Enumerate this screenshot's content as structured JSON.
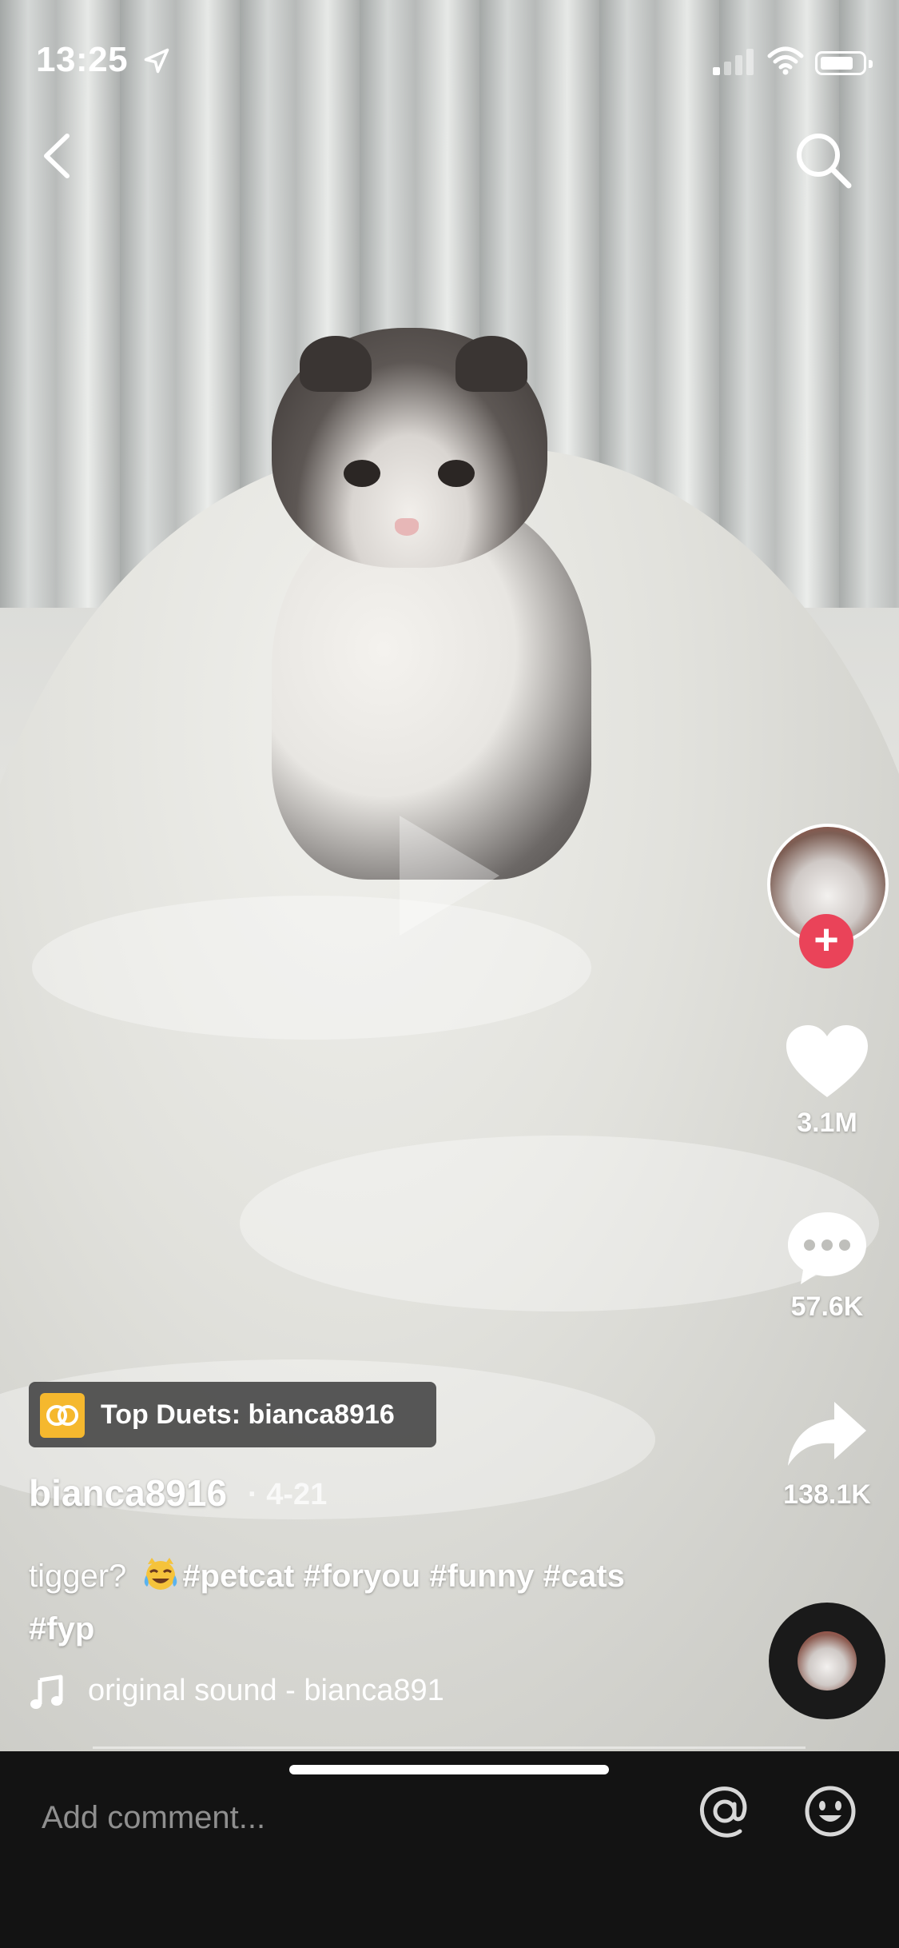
{
  "status_bar": {
    "time": "13:25"
  },
  "video": {
    "state": "paused"
  },
  "creator": {
    "username": "bianca8916",
    "date": "· 4-21"
  },
  "duets_chip": {
    "label": "Top Duets: bianca8916"
  },
  "caption": {
    "text": "tigger?",
    "emoji": "😹",
    "hashtags": "#petcat #foryou #funny #cats #fyp"
  },
  "sound": {
    "label": "original sound - bianca891"
  },
  "actions": {
    "likes": "3.1M",
    "comments": "57.6K",
    "shares": "138.1K"
  },
  "comment_bar": {
    "placeholder": "Add comment..."
  },
  "colors": {
    "accent": "#ea4359",
    "duets_icon": "#f5b82e",
    "bar_bg": "#131313"
  },
  "icons": [
    "back-icon",
    "search-icon",
    "play-icon",
    "heart-icon",
    "comment-icon",
    "share-icon",
    "music-note-icon",
    "at-icon",
    "emoji-icon"
  ]
}
